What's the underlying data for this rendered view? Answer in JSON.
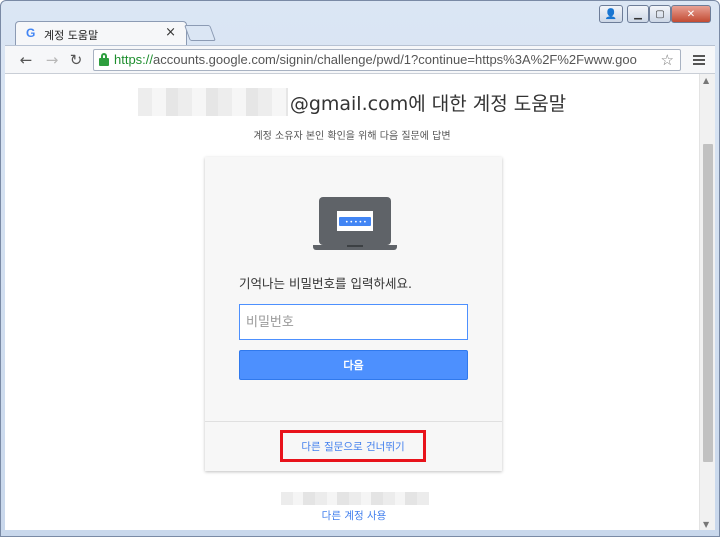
{
  "browser": {
    "tab": {
      "favicon": "G",
      "title": "계정 도움말",
      "close_glyph": "×"
    },
    "window_buttons": {
      "user_glyph": "👤",
      "minimize_glyph": "▁",
      "maximize_glyph": "▢",
      "close_glyph": "✕"
    },
    "toolbar": {
      "back_glyph": "←",
      "forward_glyph": "→",
      "reload_glyph": "↻",
      "url_scheme": "https://",
      "url_rest": "accounts.google.com/signin/challenge/pwd/1?continue=https%3A%2F%2Fwww.goo",
      "star_glyph": "☆"
    },
    "scrollbar": {
      "up_glyph": "▲",
      "down_glyph": "▼"
    }
  },
  "page": {
    "heading_text": "@gmail.com에 대한 계정 도움말",
    "subtitle": "계정 소유자 본인 확인을 위해 다음 질문에 답변",
    "card": {
      "prompt": "기억나는 비밀번호를 입력하세요.",
      "password_placeholder": "비밀번호",
      "next_button": "다음",
      "skip_link": "다른 질문으로 건너뛰기"
    },
    "other_account_link": "다른 계정 사용"
  },
  "colors": {
    "primary_button": "#4d90fe",
    "link": "#427fed",
    "highlight_box": "#e8131b",
    "secure_scheme": "#1e8e2e"
  },
  "icons": [
    "google-favicon",
    "lock-icon",
    "star-icon",
    "menu-icon",
    "laptop-password-icon"
  ]
}
